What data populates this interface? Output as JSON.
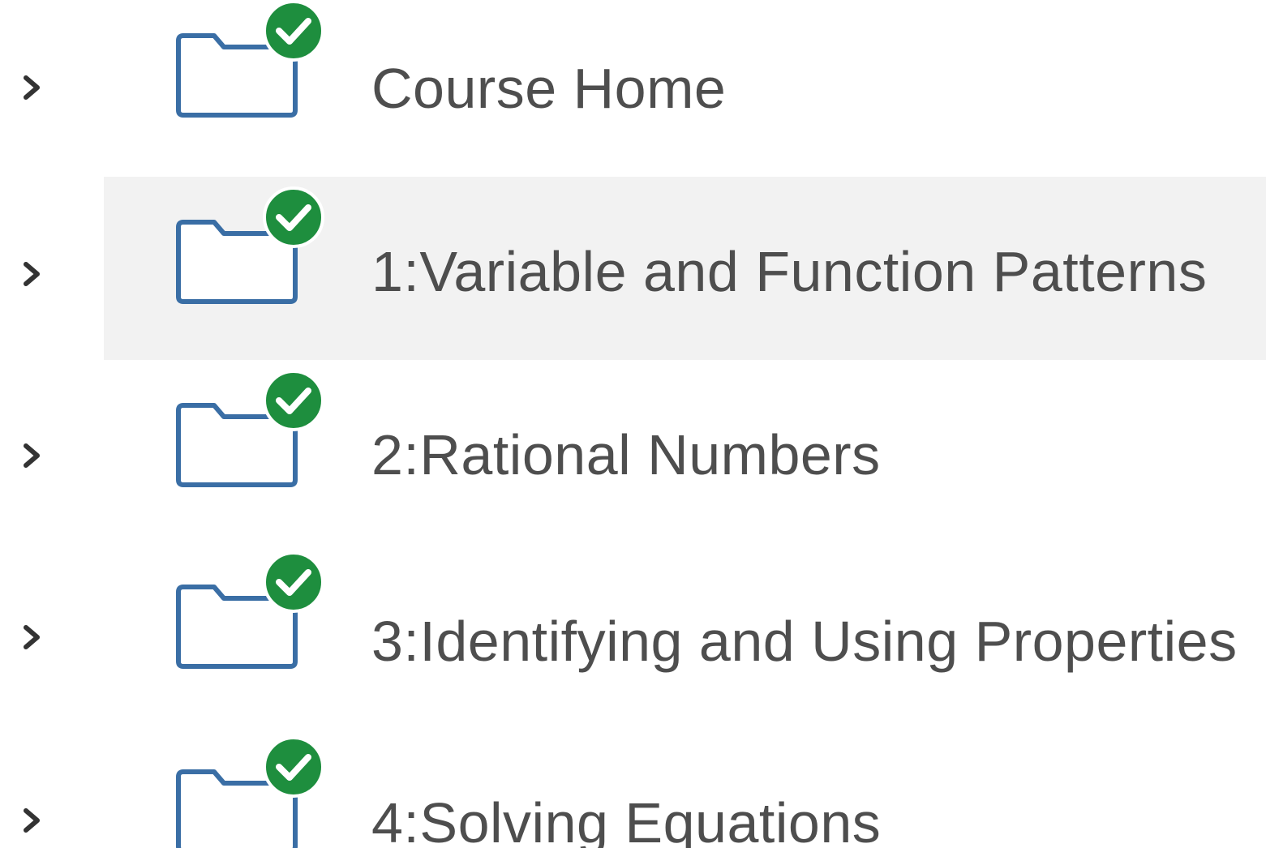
{
  "tree": {
    "items": [
      {
        "label": "Course Home",
        "expanded": false,
        "status": "complete",
        "selected": false
      },
      {
        "label": "1:Variable and Function Patterns",
        "expanded": false,
        "status": "complete",
        "selected": true
      },
      {
        "label": "2:Rational Numbers",
        "expanded": false,
        "status": "complete",
        "selected": false
      },
      {
        "label": "3:Identifying and Using Properties",
        "expanded": false,
        "status": "complete",
        "selected": false
      },
      {
        "label": "4:Solving Equations",
        "expanded": false,
        "status": "complete",
        "selected": false
      }
    ]
  },
  "colors": {
    "folder_stroke": "#3a6ea5",
    "check_badge": "#1e8e3e",
    "selected_background": "#f2f2f2",
    "label_text": "#4e4e4e",
    "chevron": "#333333"
  },
  "icons": {
    "expand": "chevron-right-icon",
    "folder": "folder-icon",
    "status": "check-circle-icon"
  }
}
